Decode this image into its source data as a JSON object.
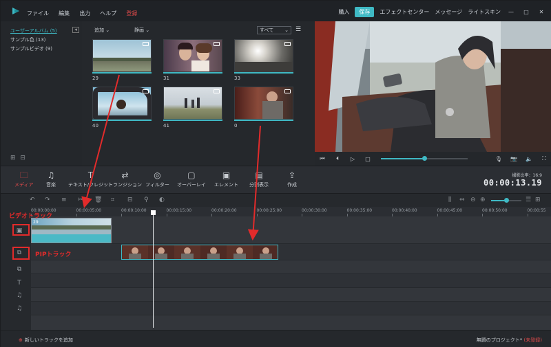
{
  "menu": {
    "items": [
      "ファイル",
      "編集",
      "出力",
      "ヘルプ"
    ],
    "register": "登録"
  },
  "titlebar_right": {
    "import": "購入",
    "export": "保存",
    "effect_center": "エフェクトセンター",
    "message": "メッセージ",
    "light_skin": "ライトスキン"
  },
  "library": {
    "items": [
      "ユーザーアルバム (5)",
      "サンプル色 (13)",
      "サンプルビデオ (9)"
    ]
  },
  "media": {
    "add_label": "追加",
    "type_label": "静画",
    "filter": "すべて",
    "thumbs": [
      {
        "label": "29"
      },
      {
        "label": "31"
      },
      {
        "label": "33"
      },
      {
        "label": "40"
      },
      {
        "label": "41"
      },
      {
        "label": "0"
      }
    ]
  },
  "toolbar": {
    "items": [
      {
        "label": "メディア",
        "icon": "folder-icon"
      },
      {
        "label": "音楽",
        "icon": "music-icon"
      },
      {
        "label": "テキスト/クレジット",
        "icon": "text-icon"
      },
      {
        "label": "トランジション",
        "icon": "transition-icon"
      },
      {
        "label": "フィルター",
        "icon": "filter-icon"
      },
      {
        "label": "オーバーレイ",
        "icon": "overlay-icon"
      },
      {
        "label": "エレメント",
        "icon": "element-icon"
      },
      {
        "label": "分割表示",
        "icon": "split-icon"
      },
      {
        "label": "作成",
        "icon": "export-icon"
      }
    ],
    "ratio": "撮影比率：16:9",
    "timecode": "00:00:13.19"
  },
  "ruler": {
    "ticks": [
      "00:00:00:00",
      "00:00:05:00",
      "00:00:10:00",
      "00:00:15:00",
      "00:00:20:00",
      "00:00:25:00",
      "00:00:30:00",
      "00:00:35:00",
      "00:00:40:00",
      "00:00:45:00",
      "00:00:50:00",
      "00:00:55"
    ]
  },
  "annotations": {
    "video_track": "ビデオトラック",
    "pip_track": "PIPトラック"
  },
  "clip": {
    "video_label": "29"
  },
  "bottom": {
    "add_track": "新しいトラックを追加",
    "project": "無題のプロジェクト*",
    "unregistered": "(未登録)"
  },
  "colors": {
    "accent": "#3fb9c4",
    "alert": "#e22b2b"
  }
}
